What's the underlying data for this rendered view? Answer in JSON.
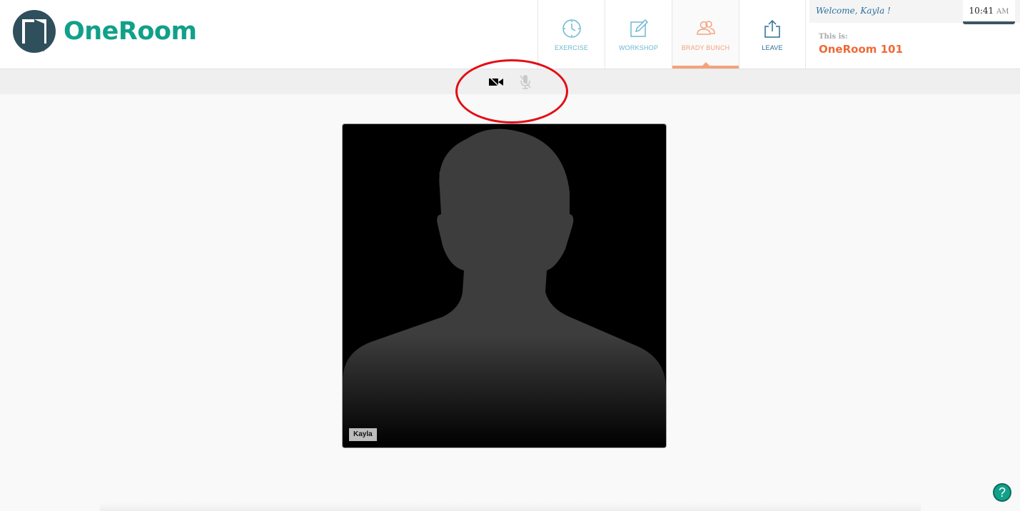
{
  "app": {
    "name": "OneRoom"
  },
  "nav": {
    "items": [
      {
        "label": "EXERCISE",
        "icon": "clock-icon"
      },
      {
        "label": "WORKSHOP",
        "icon": "edit-icon"
      },
      {
        "label": "BRADY BUNCH",
        "icon": "people-icon",
        "active": true
      },
      {
        "label": "LEAVE",
        "icon": "share-icon"
      }
    ]
  },
  "info": {
    "welcome": "Welcome, Kayla !",
    "this_is": "This is:",
    "room_name": "OneRoom 101"
  },
  "clock": {
    "time": "10:41",
    "ampm": "AM"
  },
  "toolbar": {
    "camera_icon": "video-camera-icon",
    "mic_icon": "microphone-icon"
  },
  "video": {
    "participant_name": "Kayla"
  },
  "help": {
    "label": "?"
  },
  "colors": {
    "brand": "#11a08a",
    "nav_label": "#6bb8cf",
    "active": "#f4a27e",
    "room_name": "#ef6a36",
    "annotation": "#e30d13"
  }
}
